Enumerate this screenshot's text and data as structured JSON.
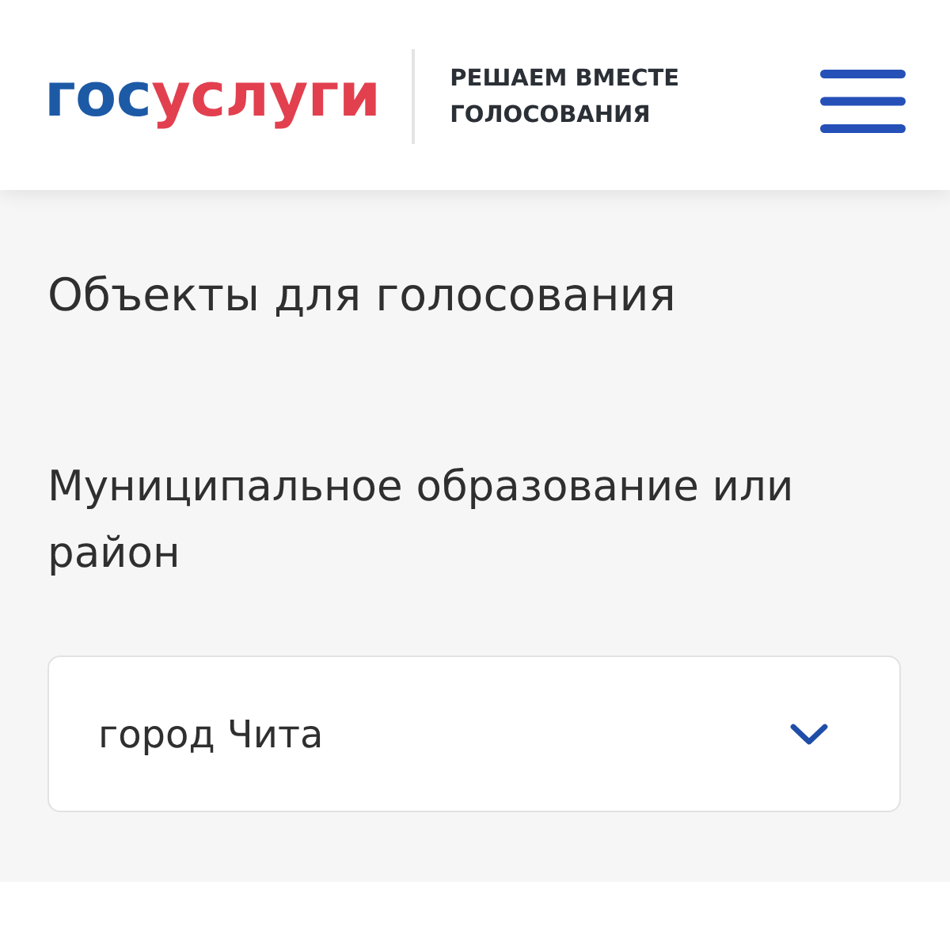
{
  "header": {
    "logo": [
      {
        "text": "гос",
        "color": "#1d5aa6"
      },
      {
        "text": "услуги",
        "color": "#e2404f"
      }
    ],
    "tagline": "РЕШАЕМ ВМЕСТЕ ГОЛОСОВАНИЯ"
  },
  "section": {
    "title": "Объекты для голосования",
    "field_label": "Муниципальное образование или район",
    "select": {
      "value": "город Чита"
    }
  }
}
